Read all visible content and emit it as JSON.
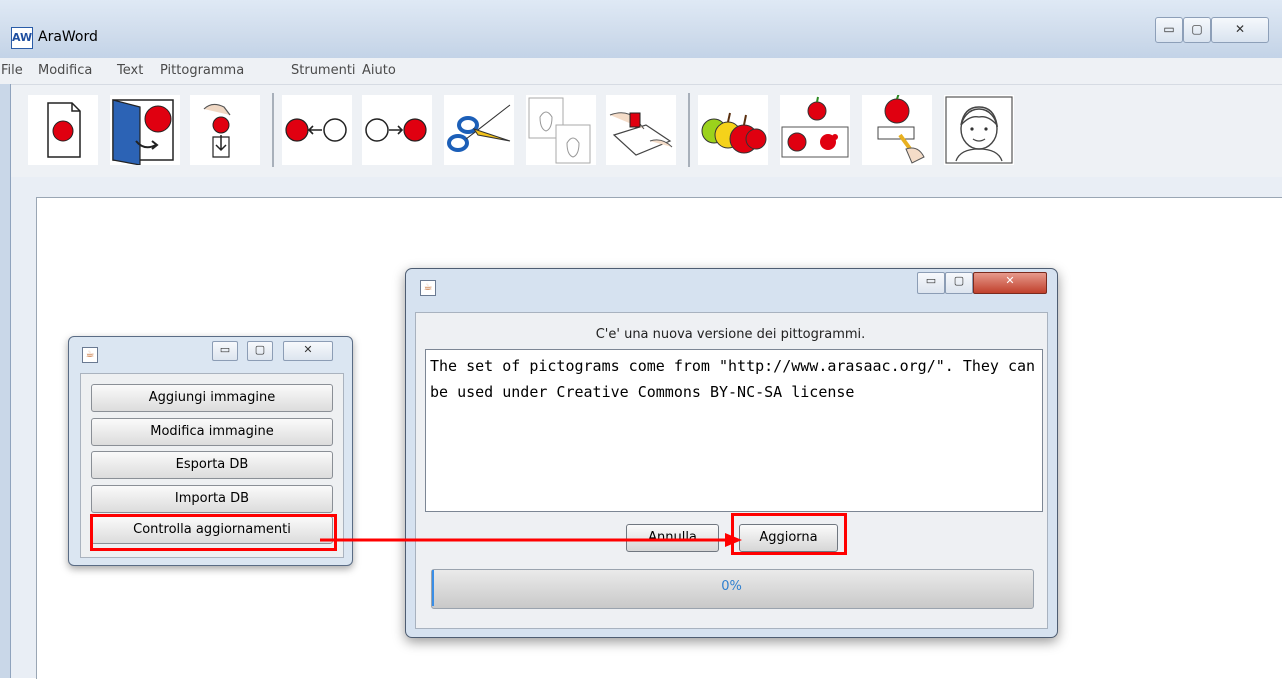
{
  "window": {
    "app_icon_text": "AW",
    "title": "AraWord",
    "minimize": "▭",
    "maximize": "▢",
    "close": "✕"
  },
  "menu": [
    "File",
    "Modifica",
    "Text",
    "Pittogramma",
    "Strumenti",
    "Aiuto"
  ],
  "toolbar": {
    "tools": [
      "new-document-icon",
      "open-icon",
      "save-icon",
      "previous-pictogram-icon",
      "next-pictogram-icon",
      "cut-icon",
      "copy-icon",
      "paste-icon",
      "change-pictogram-icon",
      "pictogram-sizes-icon",
      "edit-pictogram-icon",
      "user-icon"
    ]
  },
  "small_dialog": {
    "buttons": [
      "Aggiungi immagine",
      "Modifica immagine",
      "Esporta DB",
      "Importa DB",
      "Controlla aggiornamenti"
    ]
  },
  "update_dialog": {
    "message": "C'e' una nuova versione dei pittogrammi.",
    "license_text": "The set of pictograms come from \"http://www.arasaac.org/\". They can be used under Creative Commons BY-NC-SA license",
    "cancel_label": "Annulla",
    "update_label": "Aggiorna",
    "progress_text": "0%",
    "progress_value": 0
  },
  "colors": {
    "annotation": "#ff0000",
    "progress_text": "#2e7fcf"
  }
}
